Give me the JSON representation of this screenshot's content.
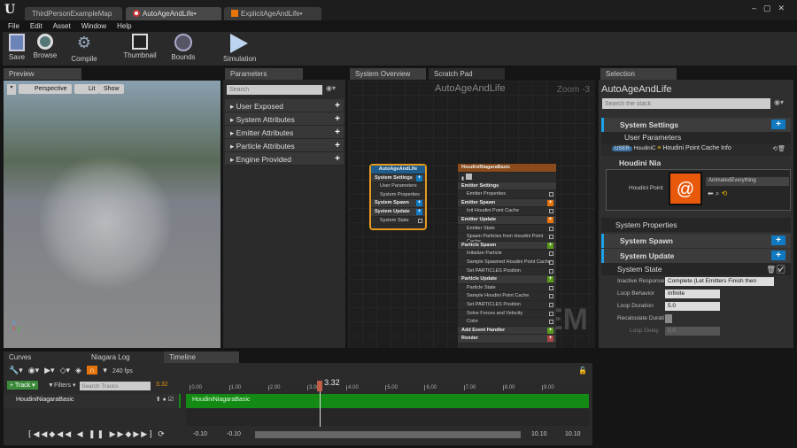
{
  "window": {
    "logo": "U",
    "tabs": [
      "ThirdPersonExampleMap",
      "AutoAgeAndLife•",
      "ExplicitAgeAndLife•"
    ]
  },
  "menu": [
    "File",
    "Edit",
    "Asset",
    "Window",
    "Help"
  ],
  "toolbar": {
    "save": "Save",
    "browse": "Browse",
    "compile": "Compile",
    "thumbnail": "Thumbnail",
    "bounds": "Bounds",
    "simulation": "Simulation"
  },
  "preview": {
    "tab": "Preview",
    "perspective": "Perspective",
    "lit": "Lit",
    "show": "Show"
  },
  "parameters": {
    "tab": "Parameters",
    "search_placeholder": "Search",
    "items": [
      "User Exposed",
      "System Attributes",
      "Emitter Attributes",
      "Particle Attributes",
      "Engine Provided"
    ]
  },
  "graph": {
    "tabs": [
      "System Overview",
      "Scratch Pad"
    ],
    "title": "AutoAgeAndLife",
    "zoom": "Zoom -3",
    "watermark": "SYSTEM",
    "system_node": {
      "title": "AutoAgeAndLife",
      "rows": [
        "System Settings",
        "User Parameters",
        "System Properties",
        "System Spawn",
        "System Update",
        "System State"
      ]
    },
    "emitter_node": {
      "title": "HoudiniNiagaraBasic",
      "rows": [
        "Emitter Settings",
        "Emitter Properties",
        "Emitter Spawn",
        "Init Houdini Point Cache",
        "Emitter Update",
        "Emitter State",
        "Spawn Particles from Houdini Point Cache",
        "Particle Spawn",
        "Initialize Particle",
        "Sample Spawned Houdini Point Cache",
        "Set PARTICLES Position",
        "Particle Update",
        "Particle State",
        "Sample Houdini Point Cache",
        "Set PARTICLES Position",
        "Solve Forces and Velocity",
        "Color",
        "Add Event Handler",
        "Render"
      ]
    }
  },
  "selection": {
    "tab": "Selection",
    "title": "AutoAgeAndLife",
    "search_placeholder": "Search the stack",
    "system_settings": "System Settings",
    "user_parameters": "User Parameters",
    "user_badge": "USER",
    "houdini_short": "HoudiniC",
    "cache_info": "Houdini Point Cache Info",
    "houdini_nia": "Houdini Nia",
    "houdini_point": "Houdini Point",
    "asset_value": "AnimatedEverything",
    "system_properties": "System Properties",
    "system_spawn": "System Spawn",
    "system_update": "System Update",
    "system_state": "System State",
    "props": [
      {
        "label": "Inactive Response",
        "value": "Complete (Let Emitters Finish then"
      },
      {
        "label": "Loop Behavior",
        "value": "Infinite"
      },
      {
        "label": "Loop Duration",
        "value": "5.0"
      },
      {
        "label": "Recalculate Durati",
        "value": ""
      },
      {
        "label": "Loop Delay",
        "value": "0.0"
      }
    ]
  },
  "bottom": {
    "tabs": [
      "Curves",
      "Niagara Log",
      "Timeline"
    ],
    "fps": "240 fps",
    "track_btn": "Track",
    "filters": "Filters",
    "search_placeholder": "Search Tracks",
    "time": "3.32",
    "track_name": "HoudiniNiagaraBasic",
    "ticks": [
      "0.00",
      "1.00",
      "2.00",
      "3.00",
      "4.00",
      "5.00",
      "6.00",
      "7.00",
      "8.00",
      "9.00"
    ],
    "playhead": "3.32",
    "range": [
      "-0.10",
      "-0.10",
      "10.10",
      "10.10"
    ]
  },
  "colors": {
    "accent": "#0f79c2",
    "orange": "#e8740c",
    "green": "#138a13"
  }
}
